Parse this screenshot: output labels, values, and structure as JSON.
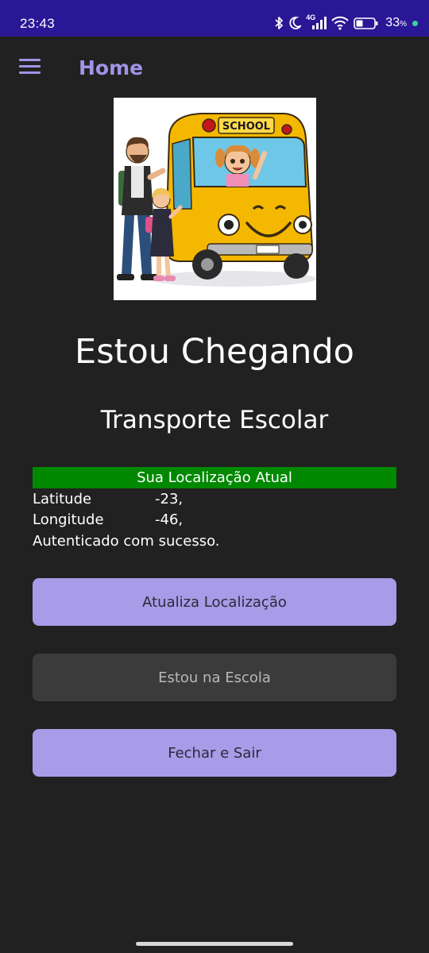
{
  "status_bar": {
    "time": "23:43",
    "network_label": "4G",
    "battery_percent": "33",
    "battery_unit": "%",
    "icons": [
      "bluetooth-icon",
      "moon-icon",
      "signal-icon",
      "wifi-icon",
      "battery-icon"
    ]
  },
  "toolbar": {
    "menu_icon": "hamburger-menu-icon",
    "title": "Home"
  },
  "hero": {
    "image": "school-bus-illustration",
    "bus_sign": "SCHOOL"
  },
  "app": {
    "name": "Estou Chegando",
    "subtitle": "Transporte Escolar"
  },
  "location": {
    "header": "Sua Localização Atual",
    "latitude_label": "Latitude",
    "latitude_value": "-23,",
    "longitude_label": "Longitude",
    "longitude_value": "-46,",
    "auth_message": "Autenticado com sucesso."
  },
  "buttons": {
    "update_location": "Atualiza Localização",
    "at_school": "Estou na Escola",
    "close_exit": "Fechar e Sair"
  },
  "colors": {
    "status_bar": "#2a1796",
    "background": "#212121",
    "accent": "#a293e6",
    "primary_button": "#a89be7",
    "disabled_button": "#3b3b3b",
    "location_header": "#008800"
  }
}
